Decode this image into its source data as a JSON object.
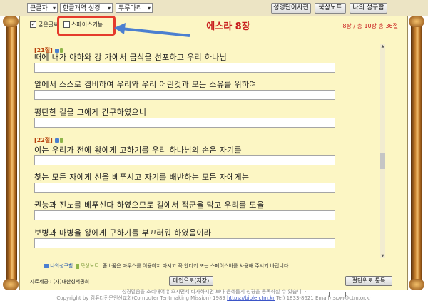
{
  "toolbar": {
    "select_font": "큰글자",
    "select_version": "한글개역 성경",
    "select_layout": "두루마리",
    "btn_dictionary": "성경단어사전",
    "btn_meditation": "묵상노트",
    "btn_mybible": "나의 성구함"
  },
  "options": {
    "bold_label": "굵은글씨",
    "space_label": "스페이스기능"
  },
  "chapter": {
    "title": "에스라 8장",
    "page_info": "8장 / 총 10장 총 36절"
  },
  "verses": [
    {
      "num": "[21절]",
      "lines": [
        "때에 내가 아하와 강 가에서 금식을 선포하고 우리 하나님",
        "앞에서 스스로 겸비하여 우리와 우리 어린것과 모든 소유를 위하여",
        "평탄한 길을 그에게 간구하였으니"
      ]
    },
    {
      "num": "[22절]",
      "lines": [
        "이는 우리가 전에 왕에게 고하기를 우리 하나님의 손은 자기를",
        "찾는 모든 자에게 선을 베푸시고 자기를 배반하는 모든 자에게는",
        "권능과 진노를 베푸신다 하였으므로 길에서 적군을 막고 우리를 도울",
        "보병과 마병을 왕에게 구하기를 부끄러워 하였음이라"
      ]
    }
  ],
  "legend": {
    "my": "나의성구함",
    "med": "묵상노트",
    "hint": "줄바꿈은 마우스를 이용하지 마시고 꼭 엔터키 또는 스페이스바를 사용해 주시기 바랍니다"
  },
  "bottom": {
    "source": "자료제공 : (재)대한성서공회",
    "main_btn": "메인으로(저장)",
    "section_btn": "절단위로 통독"
  },
  "footer": {
    "line1": "성경말씀을 소리내어 읽으시면서 타자하시면 보다 은혜롭게 성경을 통독하실 수 있습니다",
    "line2_pre": "Copyright by 컴퓨터전문인선교회(Computer Tentmaking Mission) 1989",
    "url": "https://bible.ctm.kr",
    "line2_post": "Tel) 1833-8621  Email) SDM@ctm.or.kr"
  }
}
